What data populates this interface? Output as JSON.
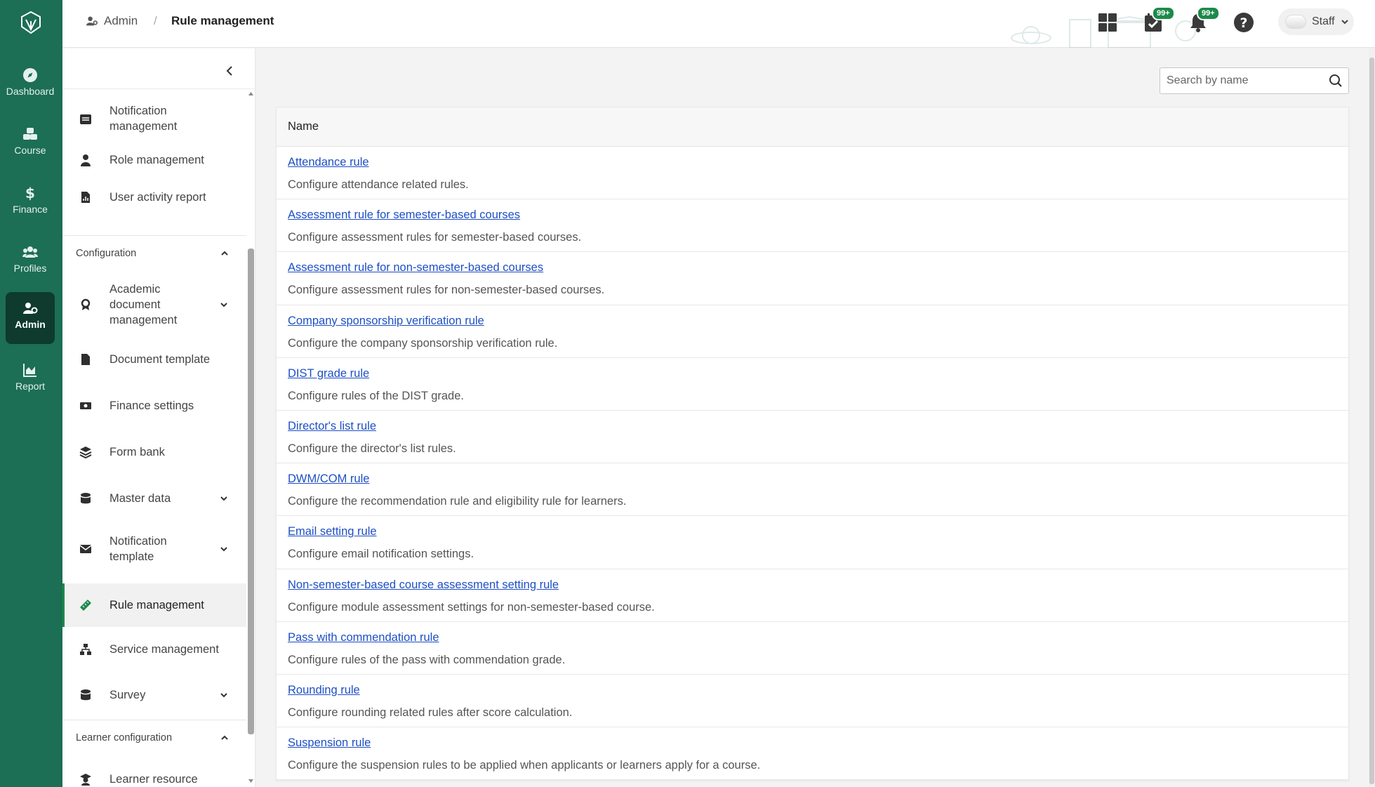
{
  "rail": {
    "items": [
      {
        "label": "Dashboard",
        "icon": "compass-icon"
      },
      {
        "label": "Course",
        "icon": "cubes-icon"
      },
      {
        "label": "Finance",
        "icon": "dollar-icon"
      },
      {
        "label": "Profiles",
        "icon": "users-icon"
      },
      {
        "label": "Admin",
        "icon": "user-gear-icon"
      },
      {
        "label": "Report",
        "icon": "chart-icon"
      }
    ],
    "active": "Admin"
  },
  "topbar": {
    "breadcrumb": {
      "parent": "Admin",
      "separator": "/",
      "current": "Rule management"
    },
    "tasks_badge": "99+",
    "notifications_badge": "99+",
    "user_label": "Staff"
  },
  "submenu": {
    "items_top": [
      {
        "label": "Notification management",
        "icon": "inbox-icon"
      },
      {
        "label": "Role management",
        "icon": "user-tie-icon"
      },
      {
        "label": "User activity report",
        "icon": "file-chart-icon"
      }
    ],
    "configuration": {
      "title": "Configuration",
      "items": [
        {
          "label": "Academic document management",
          "icon": "award-icon",
          "expandable": true
        },
        {
          "label": "Document template",
          "icon": "file-icon"
        },
        {
          "label": "Finance settings",
          "icon": "money-icon"
        },
        {
          "label": "Form bank",
          "icon": "layers-icon"
        },
        {
          "label": "Master data",
          "icon": "database-icon",
          "expandable": true
        },
        {
          "label": "Notification template",
          "icon": "envelope-icon",
          "expandable": true
        },
        {
          "label": "Rule management",
          "icon": "ruler-icon",
          "active": true
        },
        {
          "label": "Service management",
          "icon": "sitemap-icon"
        },
        {
          "label": "Survey",
          "icon": "database-icon",
          "expandable": true
        }
      ]
    },
    "learner_configuration": {
      "title": "Learner configuration",
      "items": [
        {
          "label": "Learner resource",
          "icon": "graduate-icon"
        }
      ]
    }
  },
  "search": {
    "placeholder": "Search by name",
    "value": ""
  },
  "table": {
    "header": "Name",
    "rows": [
      {
        "name": "Attendance rule",
        "description": "Configure attendance related rules."
      },
      {
        "name": "Assessment rule for semester-based courses",
        "description": "Configure assessment rules for semester-based courses."
      },
      {
        "name": "Assessment rule for non-semester-based courses",
        "description": "Configure assessment rules for non-semester-based courses."
      },
      {
        "name": "Company sponsorship verification rule",
        "description": "Configure the company sponsorship verification rule."
      },
      {
        "name": "DIST grade rule",
        "description": "Configure rules of the DIST grade."
      },
      {
        "name": "Director's list rule",
        "description": "Configure the director's list rules."
      },
      {
        "name": "DWM/COM rule",
        "description": "Configure the recommendation rule and eligibility rule for learners."
      },
      {
        "name": "Email setting rule",
        "description": "Configure email notification settings."
      },
      {
        "name": "Non-semester-based course assessment setting rule",
        "description": "Configure module assessment settings for non-semester-based course."
      },
      {
        "name": "Pass with commendation rule",
        "description": "Configure rules of the pass with commendation grade."
      },
      {
        "name": "Rounding rule",
        "description": "Configure rounding related rules after score calculation."
      },
      {
        "name": "Suspension rule",
        "description": "Configure the suspension rules to be applied when applicants or learners apply for a course."
      }
    ]
  },
  "colors": {
    "rail": "#1c6e54",
    "rail_active": "#0e3b2d",
    "link": "#1d4fc4",
    "badge": "#1c8a4a"
  }
}
